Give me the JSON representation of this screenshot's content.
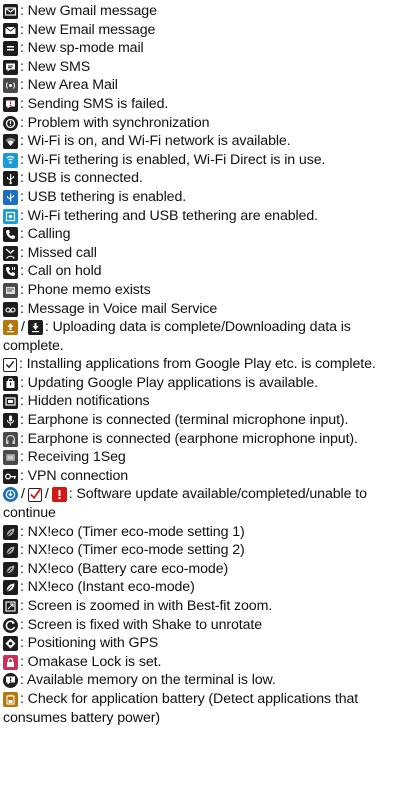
{
  "items": [
    {
      "icon": "gmail-icon",
      "text": ": New Gmail message"
    },
    {
      "icon": "email-icon",
      "text": ": New Email message"
    },
    {
      "icon": "sp-mode-mail-icon",
      "text": ": New sp-mode mail"
    },
    {
      "icon": "sms-icon",
      "text": ": New SMS"
    },
    {
      "icon": "area-mail-icon",
      "text": ": New Area Mail"
    },
    {
      "icon": "sms-failed-icon",
      "text": ": Sending SMS is failed."
    },
    {
      "icon": "sync-problem-icon",
      "text": ": Problem with synchronization"
    },
    {
      "icon": "wifi-available-icon",
      "text": ": Wi-Fi is on, and Wi-Fi network is available."
    },
    {
      "icon": "wifi-tethering-icon",
      "text": ": Wi-Fi tethering is enabled, Wi-Fi Direct is in use."
    },
    {
      "icon": "usb-connected-icon",
      "text": ": USB is connected."
    },
    {
      "icon": "usb-tethering-icon",
      "text": ": USB tethering is enabled."
    },
    {
      "icon": "wifi-usb-tethering-icon",
      "text": ": Wi-Fi tethering and USB tethering are enabled."
    },
    {
      "icon": "calling-icon",
      "text": ": Calling"
    },
    {
      "icon": "missed-call-icon",
      "text": ": Missed call"
    },
    {
      "icon": "call-on-hold-icon",
      "text": ": Call on hold"
    },
    {
      "icon": "phone-memo-icon",
      "text": ": Phone memo exists"
    },
    {
      "icon": "voice-mail-icon",
      "text": ": Message in Voice mail Service"
    }
  ],
  "upload_row": {
    "separator": "/",
    "text": ": Uploading data is complete/Downloading data is complete."
  },
  "install_row": {
    "text": ": Installing applications from Google Play etc. is complete."
  },
  "items2": [
    {
      "icon": "google-play-update-icon",
      "text": ": Updating Google Play applications is available."
    },
    {
      "icon": "hidden-notifications-icon",
      "text": ": Hidden notifications"
    },
    {
      "icon": "earphone-terminal-mic-icon",
      "text": ": Earphone is connected (terminal microphone input)."
    },
    {
      "icon": "earphone-mic-icon",
      "text": ": Earphone is connected (earphone microphone input)."
    },
    {
      "icon": "receiving-1seg-icon",
      "text": ": Receiving 1Seg"
    },
    {
      "icon": "vpn-icon",
      "text": ": VPN connection"
    }
  ],
  "software_row": {
    "separator": "/",
    "text": ": Software update available/completed/unable to continue"
  },
  "items3": [
    {
      "icon": "nxeco-timer1-icon",
      "text": ": NX!eco (Timer eco-mode setting 1)"
    },
    {
      "icon": "nxeco-timer2-icon",
      "text": ": NX!eco (Timer eco-mode setting 2)"
    },
    {
      "icon": "nxeco-battery-care-icon",
      "text": ": NX!eco (Battery care eco-mode)"
    },
    {
      "icon": "nxeco-instant-icon",
      "text": ": NX!eco (Instant eco-mode)"
    },
    {
      "icon": "best-fit-zoom-icon",
      "text": ": Screen is zoomed in with Best-fit zoom."
    },
    {
      "icon": "shake-to-unrotate-icon",
      "text": ": Screen is fixed with Shake to unrotate"
    },
    {
      "icon": "gps-icon",
      "text": ": Positioning with GPS"
    },
    {
      "icon": "omakase-lock-icon",
      "text": ": Omakase Lock is set."
    },
    {
      "icon": "low-memory-icon",
      "text": ": Available memory on the terminal is low."
    }
  ],
  "battery_row": {
    "text": ": Check for application battery (Detect applications that consumes battery power)"
  }
}
